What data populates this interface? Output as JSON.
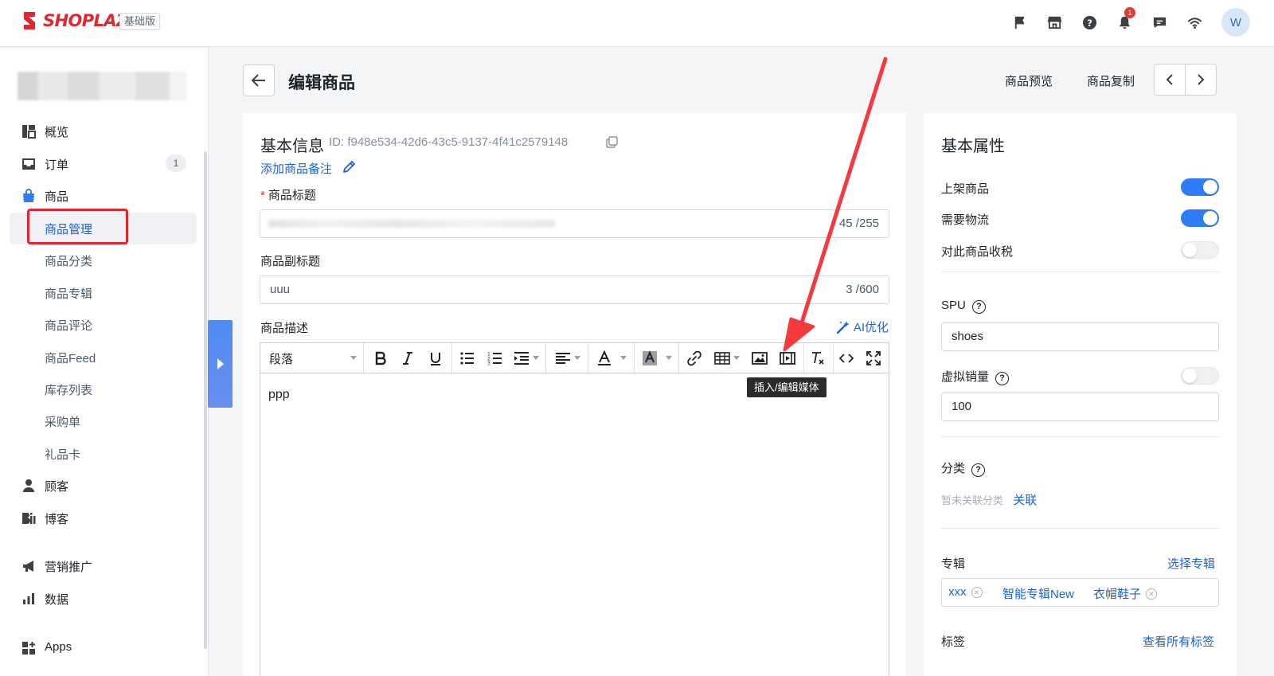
{
  "topbar": {
    "logo_text": "SHOPLAZZA",
    "plan_badge": "基础版",
    "notification_count": "1",
    "avatar_initial": "W",
    "icons": [
      "flag-icon",
      "store-icon",
      "help-icon",
      "bell-icon",
      "chat-icon",
      "wifi-icon"
    ]
  },
  "sidebar": {
    "items": [
      {
        "label": "概览",
        "icon": "dashboard-icon"
      },
      {
        "label": "订单",
        "icon": "inbox-icon",
        "count": "1"
      },
      {
        "label": "商品",
        "icon": "bag-icon"
      },
      {
        "label": "顾客",
        "icon": "person-icon"
      },
      {
        "label": "博客",
        "icon": "blog-icon"
      },
      {
        "label": "营销推广",
        "icon": "megaphone-icon"
      },
      {
        "label": "数据",
        "icon": "bar-chart-icon"
      },
      {
        "label": "Apps",
        "icon": "apps-icon"
      }
    ],
    "product_subitems": [
      "商品管理",
      "商品分类",
      "商品专辑",
      "商品评论",
      "商品Feed",
      "库存列表",
      "采购单",
      "礼品卡"
    ],
    "active_subitem": "商品管理"
  },
  "header": {
    "title": "编辑商品",
    "preview_label": "商品预览",
    "duplicate_label": "商品复制"
  },
  "basic_info": {
    "section_title": "基本信息",
    "product_id": "ID: f948e534-42d6-43c5-9137-4f41c2579148",
    "add_remark_label": "添加商品备注",
    "title_label": "商品标题",
    "title_required_mark": "*",
    "title_counter": "45 /255",
    "subtitle_label": "商品副标题",
    "subtitle_value": "uuu",
    "subtitle_counter": "3 /600",
    "description_label": "商品描述",
    "ai_optimize_label": "AI优化"
  },
  "editor": {
    "paragraph_format": "段落",
    "content": "ppp",
    "tooltip": "插入/编辑媒体"
  },
  "attributes": {
    "section_title": "基本属性",
    "publish_label": "上架商品",
    "publish_on": true,
    "shipping_label": "需要物流",
    "shipping_on": true,
    "tax_label": "对此商品收税",
    "tax_on": false,
    "spu_label": "SPU",
    "spu_value": "shoes",
    "virtual_sales_label": "虚拟销量",
    "virtual_sales_on": false,
    "virtual_sales_value": "100",
    "category_label": "分类",
    "category_empty": "暂未关联分类",
    "category_link": "关联",
    "collections_label": "专辑",
    "collections_link": "选择专辑",
    "collections": [
      "xxx",
      "智能专辑New",
      "衣帽鞋子"
    ],
    "tags_label": "标签",
    "tags_link": "查看所有标签"
  },
  "colors": {
    "brand_red": "#e0262f",
    "link_blue": "#1b63d6",
    "toggle_on": "#2f7df6",
    "annotation_red": "#e5242f"
  }
}
